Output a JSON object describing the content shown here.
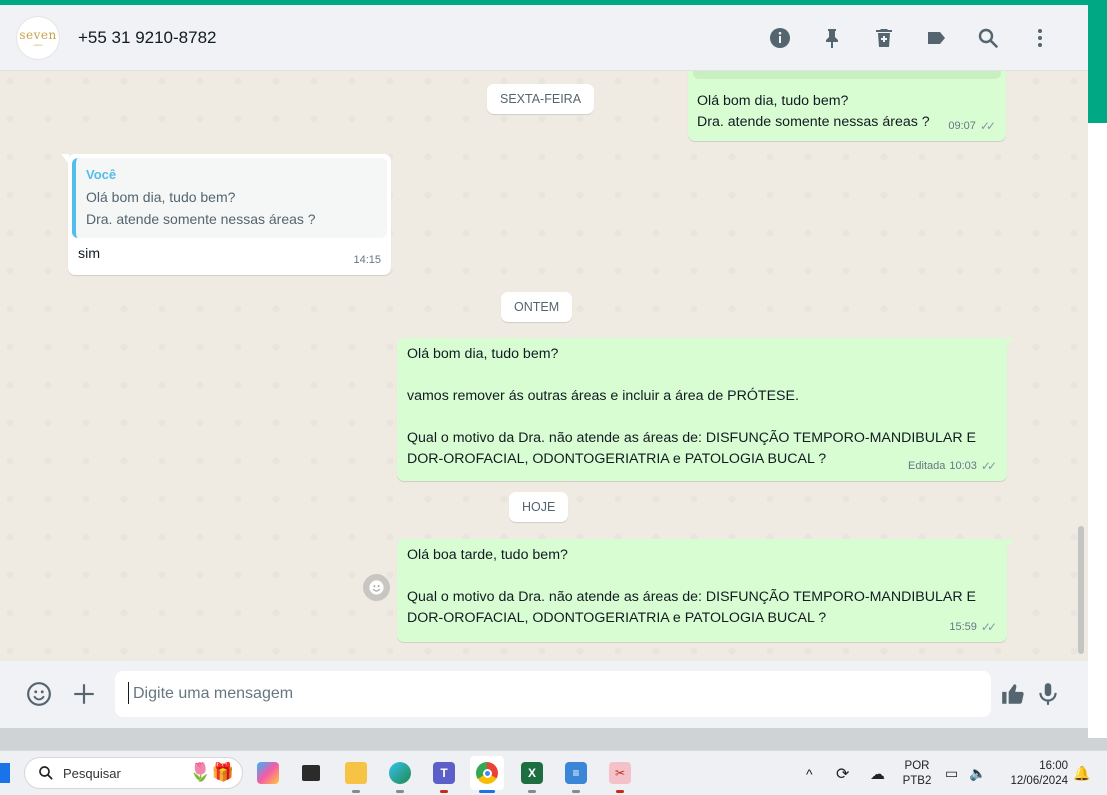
{
  "colors": {
    "accent": "#00a884",
    "outgoing_bubble": "#d9fdd3",
    "incoming_bubble": "#ffffff",
    "chat_background": "#efeae2",
    "quote_bar": "#53bdeb"
  },
  "header": {
    "avatar_logo": "seven",
    "avatar_logo_sub": "odonto",
    "contact_name": "+55 31 9210-8782",
    "icons": [
      "info-icon",
      "pin-icon",
      "delete-icon",
      "label-icon",
      "search-icon",
      "menu-icon"
    ]
  },
  "chat": {
    "date_friday": "SEXTA-FEIRA",
    "date_yesterday": "ONTEM",
    "date_today": "HOJE",
    "msg1": {
      "text": "Olá bom dia, tudo bem?\nDra. atende somente nessas áreas ?",
      "time": "09:07",
      "ticks": "✓✓"
    },
    "msg2": {
      "quote_author": "Você",
      "quote_text": "Olá bom dia, tudo bem?\nDra. atende somente nessas áreas ?",
      "text": "sim",
      "time": "14:15"
    },
    "msg3": {
      "text": "Olá bom dia, tudo bem?\n\nvamos remover ás outras áreas e incluir a área de PRÓTESE.\n\nQual o motivo da Dra. não atende as áreas de: DISFUNÇÃO TEMPORO-MANDIBULAR E DOR-OROFACIAL, ODONTOGERIATRIA e PATOLOGIA BUCAL ?",
      "edited": "Editada",
      "time": "10:03",
      "ticks": "✓✓"
    },
    "msg4": {
      "text": "Olá boa tarde, tudo bem?\n\nQual o motivo da Dra. não atende as áreas de: DISFUNÇÃO TEMPORO-MANDIBULAR E DOR-OROFACIAL, ODONTOGERIATRIA e PATOLOGIA BUCAL ?",
      "time": "15:59",
      "ticks": "✓✓"
    }
  },
  "composer": {
    "placeholder": "Digite uma mensagem"
  },
  "taskbar": {
    "search_label": "Pesquisar",
    "language_line1": "POR",
    "language_line2": "PTB2",
    "time": "16:00",
    "date": "12/06/2024",
    "apps": [
      "copilot",
      "task-view",
      "file-explorer",
      "edge",
      "teams",
      "chrome",
      "excel",
      "notepad",
      "snipping-tool"
    ]
  }
}
